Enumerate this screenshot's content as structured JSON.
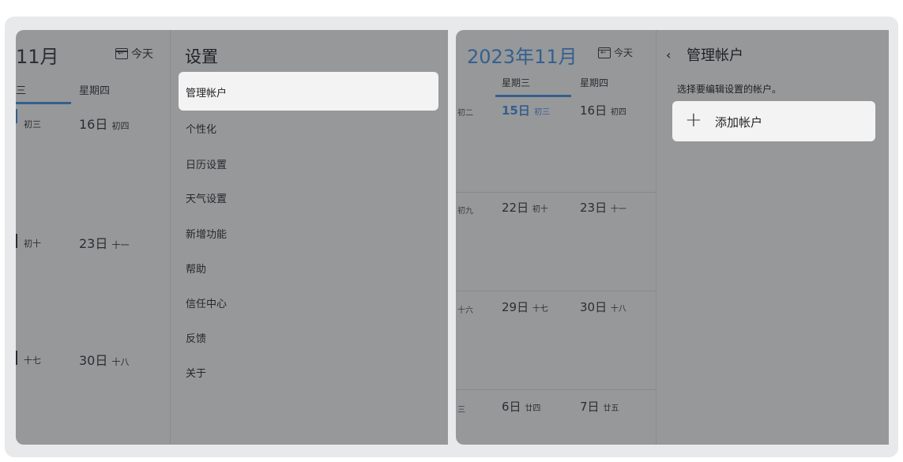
{
  "left_calendar": {
    "month_title": "11月",
    "today_label": "今天",
    "weekday_3": "三",
    "weekday_4": "星期四",
    "rows": [
      {
        "c3": "初三",
        "c4_day": "16日",
        "c4_lunar": "初四"
      },
      {
        "c3": "初十",
        "c4_day": "23日",
        "c4_lunar": "十一"
      },
      {
        "c3": "十七",
        "c4_day": "30日",
        "c4_lunar": "十八"
      }
    ]
  },
  "settings": {
    "title": "设置",
    "items": [
      "管理帐户",
      "个性化",
      "日历设置",
      "天气设置",
      "新增功能",
      "帮助",
      "信任中心",
      "反馈",
      "关于"
    ]
  },
  "right_calendar": {
    "month_title": "2023年11月",
    "today_label": "今天",
    "weekday_3": "星期三",
    "weekday_4": "星期四",
    "rows": [
      {
        "c2": "初二",
        "c3_day": "15日",
        "c3_lunar": "初三",
        "c4_day": "16日",
        "c4_lunar": "初四"
      },
      {
        "c2": "初九",
        "c3_day": "22日",
        "c3_lunar": "初十",
        "c4_day": "23日",
        "c4_lunar": "十一"
      },
      {
        "c2": "十六",
        "c3_day": "29日",
        "c3_lunar": "十七",
        "c4_day": "30日",
        "c4_lunar": "十八"
      },
      {
        "c2": "三",
        "c3_day": "6日",
        "c3_lunar": "廿四",
        "c4_day": "7日",
        "c4_lunar": "廿五"
      }
    ]
  },
  "manage_accounts": {
    "back_glyph": "‹",
    "title": "管理帐户",
    "description": "选择要编辑设置的帐户。",
    "add_account_label": "添加帐户",
    "add_glyph": "+"
  },
  "colors": {
    "accent_blue": "#345f8e",
    "overlay_gray": "#97989a",
    "selected_bg": "#f3f3f3"
  }
}
